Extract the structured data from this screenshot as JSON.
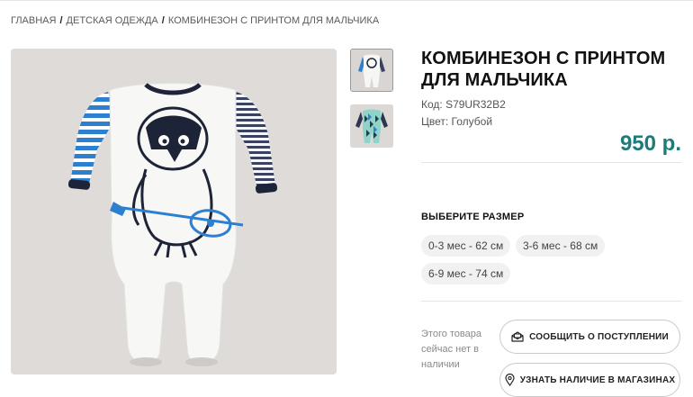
{
  "breadcrumb": {
    "items": [
      "ГЛАВНАЯ",
      "ДЕТСКАЯ ОДЕЖДА",
      "КОМБИНЕЗОН С ПРИНТОМ ДЛЯ МАЛЬЧИКА"
    ],
    "separator": "/"
  },
  "product": {
    "title": "КОМБИНЕЗОН С ПРИНТОМ ДЛЯ МАЛЬЧИКА",
    "code": "Код: S79UR32B2",
    "color": "Цвет: Голубой",
    "price": "950 р."
  },
  "sizes": {
    "title": "ВЫБЕРИТЕ РАЗМЕР",
    "options": [
      "0-3 мес - 62 см",
      "3-6 мес - 68 см",
      "6-9 мес - 74 см"
    ]
  },
  "availability": {
    "note": "Этого товара сейчас нет в наличии",
    "notify_button": "СООБЩИТЬ О ПОСТУПЛЕНИИ",
    "stores_button": "УЗНАТЬ НАЛИЧИЕ В МАГАЗИНАХ"
  },
  "icons": {
    "notify": "envelope-icon",
    "stores": "location-pin-icon"
  },
  "colors": {
    "price": "#1f7a78",
    "pill_bg": "#f1f1f1",
    "photo_bg": "#dfdbd8"
  }
}
